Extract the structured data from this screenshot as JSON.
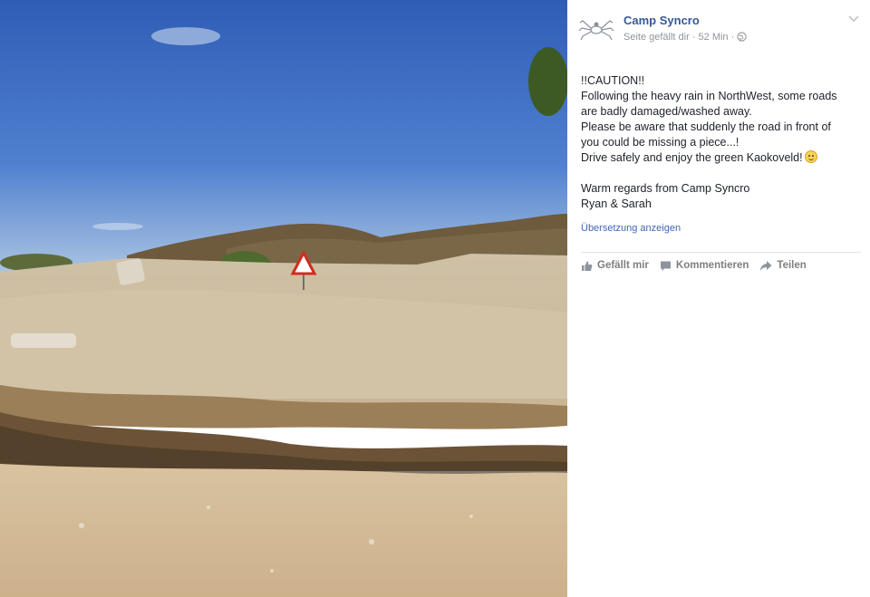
{
  "post": {
    "author": "Camp Syncro",
    "meta": "Seite gefällt dir · 52 Min ·",
    "text_lines": [
      "!!CAUTION!!",
      "Following the heavy rain in NorthWest, some roads",
      "are badly damaged/washed away.",
      "Please be aware that suddenly the road in front of",
      "you could be missing a piece...!",
      "Drive safely and enjoy the green Kaokoveld!",
      "",
      "Warm regards from Camp Syncro",
      "Ryan & Sarah"
    ],
    "translate_link": "Übersetzung anzeigen"
  },
  "actions": {
    "like": "Gefällt mir",
    "comment": "Kommentieren",
    "share": "Teilen"
  },
  "icons": {
    "avatar": "spider-logo-icon",
    "options": "chevron-down-icon",
    "privacy": "globe-icon",
    "like": "thumbs-up-icon",
    "comment": "comment-icon",
    "share": "share-arrow-icon",
    "emoji": "smiley-icon"
  },
  "colors": {
    "link": "#365899",
    "meta": "#90949c",
    "text": "#1d2129",
    "action": "#7f7f7f",
    "sky": "#3f6ec0"
  }
}
